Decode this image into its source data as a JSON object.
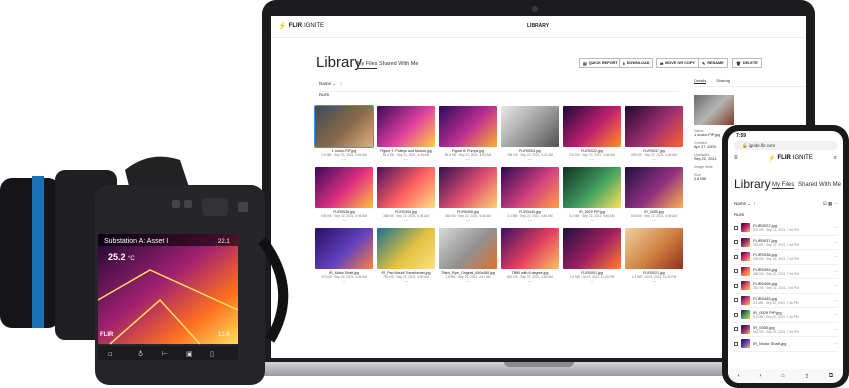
{
  "laptop": {
    "brand": "FLIR",
    "brand_suffix": "IGNITE",
    "nav_item": "LIBRARY",
    "title": "Library",
    "tabs": [
      "My Files",
      "Shared With Me"
    ],
    "buttons": [
      {
        "label": "QUICK REPORT",
        "icon": "report-icon"
      },
      {
        "label": "DOWNLOAD",
        "icon": "download-icon"
      },
      {
        "label": "MOVE OR COPY",
        "icon": "move-icon"
      },
      {
        "label": "RENAME",
        "icon": "rename-icon"
      },
      {
        "label": "DELETE",
        "icon": "trash-icon"
      }
    ],
    "sort_label": "Name",
    "files_header": "FILES",
    "files": [
      {
        "name": "1 motor-PIP.jpg",
        "meta": "2.8 MB · Sep 22, 2021, 4:46 AM",
        "colors": [
          "#3d4a55",
          "#8a6a4a",
          "#e0b080"
        ],
        "selected": true
      },
      {
        "name": "Figure 7: Pulleys and Motors.jpg",
        "meta": "82.4 KB · Sep 22, 2021, 4:46 AM",
        "colors": [
          "#3a0a5a",
          "#e040a0",
          "#ffd040"
        ]
      },
      {
        "name": "Figure 8: Pumps.jpg",
        "meta": "85.8 KB · Sep 22, 2021, 4:50 AM",
        "colors": [
          "#2a0a60",
          "#c03090",
          "#ffb030"
        ]
      },
      {
        "name": "FLIR0004.jpg",
        "meta": "784 KB · Sep 22, 2021, 4:47 AM",
        "colors": [
          "#e8e8e8",
          "#9a9a9a",
          "#505050"
        ]
      },
      {
        "name": "FLIR0022.jpg",
        "meta": "201 KB · Sep 22, 2021, 4:46 AM",
        "colors": [
          "#1a0a3a",
          "#c02070",
          "#ff9020"
        ]
      },
      {
        "name": "FLIR0037.jpg",
        "meta": "283 KB · Sep 22, 2021, 4:46 AM",
        "colors": [
          "#200830",
          "#a03070",
          "#ff6030"
        ]
      },
      {
        "name": "FLIR0038.jpg",
        "meta": "535 KB · Sep 22, 2021, 4:46 AM",
        "colors": [
          "#3a0a60",
          "#e03080",
          "#ffc040"
        ]
      },
      {
        "name": "FLIR0394.jpg",
        "meta": "388 KB · Sep 22, 2021, 4:46 AM",
        "colors": [
          "#4a1060",
          "#ff6060",
          "#ffe080"
        ]
      },
      {
        "name": "FLIR0406.jpg",
        "meta": "352 KB · Sep 22, 2021, 4:46 AM",
        "colors": [
          "#301050",
          "#e05070",
          "#ffd070"
        ]
      },
      {
        "name": "FLIR0445.jpg",
        "meta": "3.4 MB · Sep 22, 2021, 4:46 AM",
        "colors": [
          "#2a0a50",
          "#d04080",
          "#ffa040"
        ]
      },
      {
        "name": "IR_0029 PIP.jpg",
        "meta": "5.2 MB · Sep 22, 2021, 4:46 AM",
        "colors": [
          "#103020",
          "#40a060",
          "#ffe060"
        ]
      },
      {
        "name": "IR_0050.jpg",
        "meta": "843 KB · Sep 22, 2021, 4:46 AM",
        "colors": [
          "#201040",
          "#903080",
          "#ffb050"
        ]
      },
      {
        "name": "IR_Motor Shaft.jpg",
        "meta": "375 KB · Sep 22, 2021, 4:46 AM",
        "colors": [
          "#2a1060",
          "#6040c0",
          "#ff8040"
        ]
      },
      {
        "name": "IR_Pad Mount Transformer.jpg",
        "meta": "791 KB · Sep 22, 2021, 4:50 AM",
        "colors": [
          "#1a7090",
          "#e0c040",
          "#ffe080"
        ]
      },
      {
        "name": "Tilted_Pipe_Original_640x480.jpg",
        "meta": "1.8 MB · Sep 22, 2021, 4:47 AM",
        "colors": [
          "#d8d8d8",
          "#909090",
          "#e07030"
        ]
      },
      {
        "name": "TB80 with 6 degree.jpg",
        "meta": "862 KB · Sep 22, 2021, 4:50 AM",
        "colors": [
          "#3a1060",
          "#e04060",
          "#ffc060"
        ]
      },
      {
        "name": "FLIR0001.jpg",
        "meta": "1.0 MB · Oct 5, 2021, 11:34 PM",
        "colors": [
          "#201040",
          "#a02060",
          "#ff8030"
        ]
      },
      {
        "name": "FLIR0021.jpg",
        "meta": "1.4 MB · Oct 5, 2021, 11:34 PM",
        "colors": [
          "#f0d0a0",
          "#d08040",
          "#903020"
        ]
      }
    ],
    "details": {
      "tabs": [
        "Details",
        "Sharing"
      ],
      "name_label": "Name",
      "name_value": "1 motor-PIP.jpg",
      "created_label": "Created",
      "created_value": "Apr 27, 2009",
      "uploaded_label": "Uploaded",
      "uploaded_value": "Sep 22, 2021",
      "image_label": "Image dims",
      "size_label": "Size",
      "size_value": "2.8 MB"
    }
  },
  "camera": {
    "header": "Substation A: Asset I",
    "temp_value": "25.2",
    "temp_unit": "°C",
    "scale_high": "22.1",
    "scale_low": "12.6",
    "brand": "FLIR"
  },
  "phone": {
    "time": "7:59",
    "url": "ignite.flir.com",
    "brand": "FLIR",
    "brand_suffix": "IGNITE",
    "title": "Library",
    "tabs": [
      "My Files",
      "Shared With Me"
    ],
    "sort_label": "Name",
    "files_header": "FILES",
    "files": [
      {
        "name": "FLIR0022.jpg",
        "meta": "201 KB · Sep 22, 2021, 7:46 PM",
        "color": "#c02070"
      },
      {
        "name": "FLIR0037.jpg",
        "meta": "283 KB · Sep 22, 2021, 7:46 PM",
        "color": "#a03070"
      },
      {
        "name": "FLIR0038.jpg",
        "meta": "535 KB · Sep 22, 2021, 7:46 PM",
        "color": "#e03080"
      },
      {
        "name": "FLIR0394.jpg",
        "meta": "388 KB · Sep 22, 2021, 7:46 PM",
        "color": "#ff6060"
      },
      {
        "name": "FLIR0406.jpg",
        "meta": "352 KB · Sep 22, 2021, 7:46 PM",
        "color": "#e05070"
      },
      {
        "name": "FLIR0445.jpg",
        "meta": "3.4 MB · Sep 22, 2021, 7:46 PM",
        "color": "#d04080"
      },
      {
        "name": "IR_0029 PIP.jpg",
        "meta": "5.2 MB · Sep 22, 2021, 7:46 PM",
        "color": "#40a060"
      },
      {
        "name": "IR_0050.jpg",
        "meta": "843 KB · Sep 22, 2021, 7:46 PM",
        "color": "#903080"
      },
      {
        "name": "IR_Motor Shaft.jpg",
        "meta": "",
        "color": "#6040c0"
      }
    ]
  }
}
